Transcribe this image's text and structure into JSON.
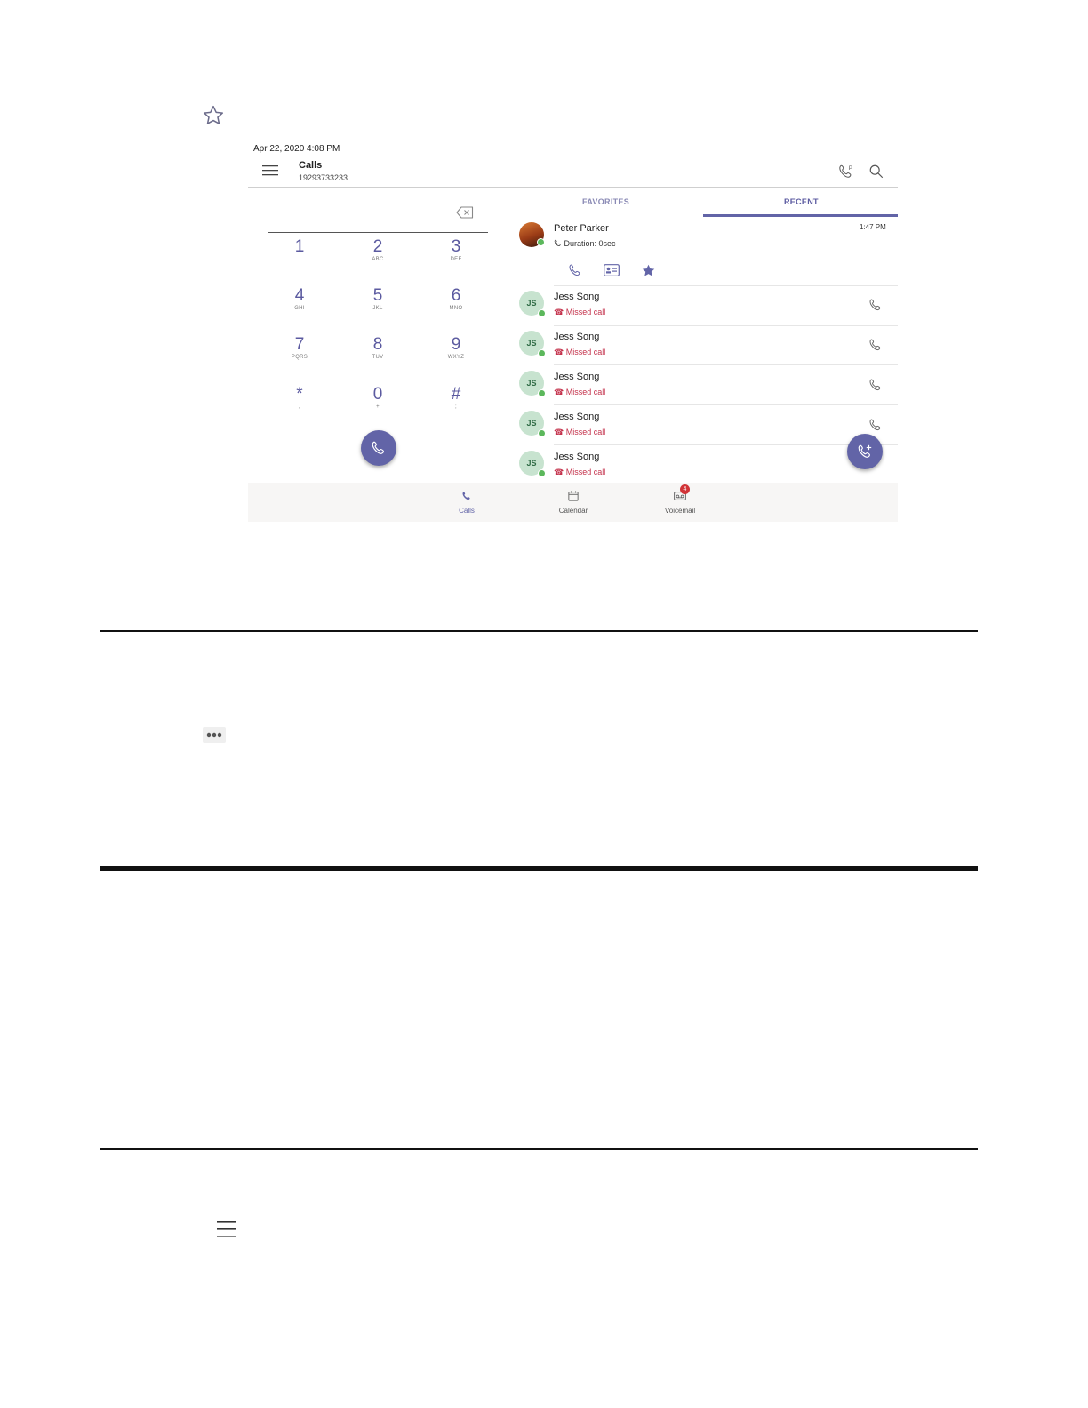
{
  "status_bar": {
    "datetime": "Apr 22, 2020  4:08 PM"
  },
  "header": {
    "title": "Calls",
    "number": "19293733233"
  },
  "tabs": [
    {
      "label": "FAVORITES",
      "active": false
    },
    {
      "label": "RECENT",
      "active": true
    }
  ],
  "dialpad": {
    "keys": [
      {
        "digit": "1",
        "letters": ""
      },
      {
        "digit": "2",
        "letters": "ABC"
      },
      {
        "digit": "3",
        "letters": "DEF"
      },
      {
        "digit": "4",
        "letters": "GHI"
      },
      {
        "digit": "5",
        "letters": "JKL"
      },
      {
        "digit": "6",
        "letters": "MNO"
      },
      {
        "digit": "7",
        "letters": "PQRS"
      },
      {
        "digit": "8",
        "letters": "TUV"
      },
      {
        "digit": "9",
        "letters": "WXYZ"
      },
      {
        "digit": "*",
        "letters": ","
      },
      {
        "digit": "0",
        "letters": "+"
      },
      {
        "digit": "#",
        "letters": ";"
      }
    ]
  },
  "recent": {
    "expanded": {
      "name": "Peter Parker",
      "detail": "Duration: 0sec",
      "time": "1:47 PM"
    },
    "items": [
      {
        "initials": "JS",
        "name": "Jess Song",
        "status": "Missed call"
      },
      {
        "initials": "JS",
        "name": "Jess Song",
        "status": "Missed call"
      },
      {
        "initials": "JS",
        "name": "Jess Song",
        "status": "Missed call"
      },
      {
        "initials": "JS",
        "name": "Jess Song",
        "status": "Missed call"
      },
      {
        "initials": "JS",
        "name": "Jess Song",
        "status": "Missed call"
      }
    ]
  },
  "bottom_nav": [
    {
      "label": "Calls",
      "icon": "phone-icon",
      "active": true
    },
    {
      "label": "Calendar",
      "icon": "calendar-icon",
      "active": false
    },
    {
      "label": "Voicemail",
      "icon": "voicemail-icon",
      "active": false,
      "badge": "4"
    }
  ],
  "colors": {
    "accent": "#6264a7",
    "missed": "#c4314b",
    "presence": "#5cb85c",
    "badge": "#d13438"
  },
  "icons": [
    "star-outline-icon",
    "more-options-icon",
    "hamburger-menu-icon"
  ]
}
